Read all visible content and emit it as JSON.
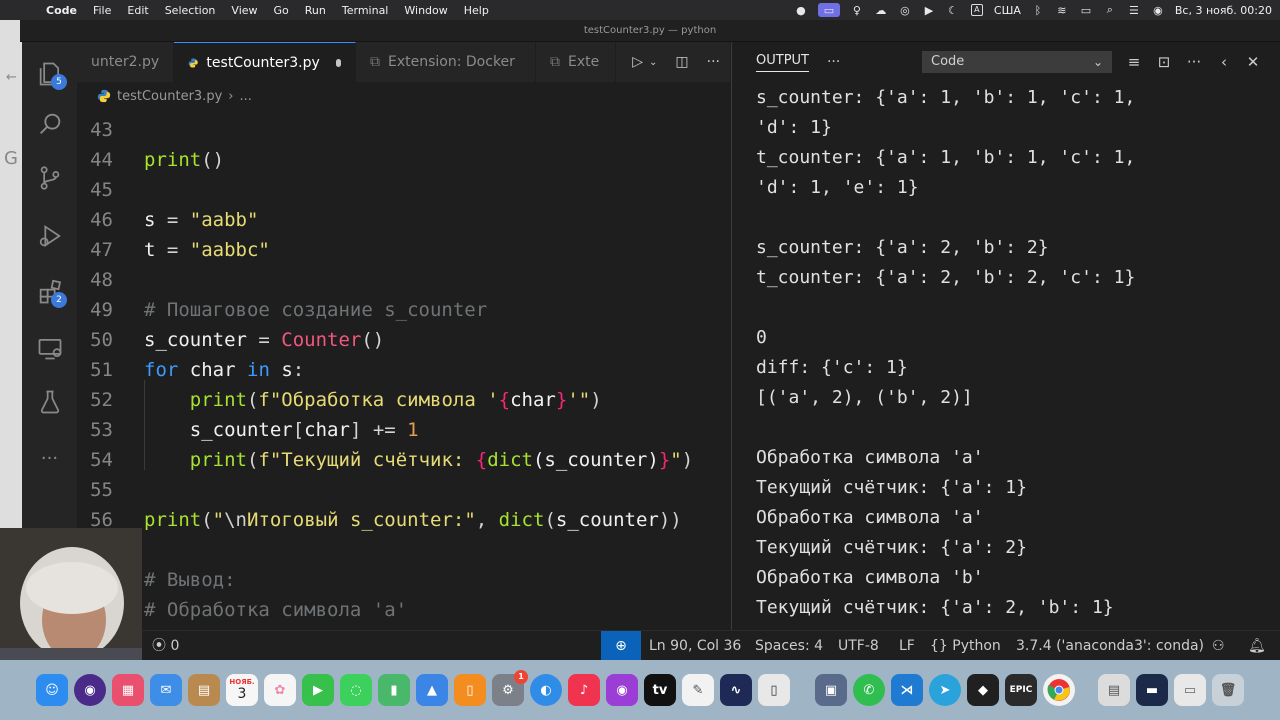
{
  "menubar": {
    "app_name": "Code",
    "items": [
      "File",
      "Edit",
      "Selection",
      "View",
      "Go",
      "Run",
      "Terminal",
      "Window",
      "Help"
    ],
    "keyboard_layout": "США",
    "keyboard_badge": "A",
    "datetime": "Вс, 3 нояб. 00:20"
  },
  "window": {
    "title": "testCounter3.py — python"
  },
  "activity_bar": {
    "explorer_badge": "5",
    "extensions_badge": "2"
  },
  "editor": {
    "tabs": [
      {
        "label": "unter2.py",
        "active": false
      },
      {
        "label": "testCounter3.py",
        "active": true
      },
      {
        "label": "Extension: Docker",
        "active": false
      },
      {
        "label": "Exte",
        "active": false
      }
    ],
    "breadcrumb": {
      "file": "testCounter3.py",
      "more": "..."
    },
    "lines": [
      {
        "num": "43",
        "text": ""
      },
      {
        "num": "44",
        "text": "print()"
      },
      {
        "num": "45",
        "text": ""
      },
      {
        "num": "46",
        "text": "s = \"aabb\""
      },
      {
        "num": "47",
        "text": "t = \"aabbc\""
      },
      {
        "num": "48",
        "text": ""
      },
      {
        "num": "49",
        "text": "# Пошаговое создание s_counter"
      },
      {
        "num": "50",
        "text": "s_counter = Counter()"
      },
      {
        "num": "51",
        "text": "for char in s:"
      },
      {
        "num": "52",
        "text": "    print(f\"Обработка символа '{char}'\")"
      },
      {
        "num": "53",
        "text": "    s_counter[char] += 1"
      },
      {
        "num": "54",
        "text": "    print(f\"Текущий счётчик: {dict(s_counter)}\")"
      },
      {
        "num": "55",
        "text": ""
      },
      {
        "num": "56",
        "text": "print(\"\\nИтоговый s_counter:\", dict(s_counter))"
      },
      {
        "num": "",
        "text": ""
      },
      {
        "num": "",
        "text": "# Вывод:"
      },
      {
        "num": "",
        "text": "# Обработка символа 'a'"
      }
    ]
  },
  "output": {
    "title": "OUTPUT",
    "more": "···",
    "channel": "Code",
    "lines": [
      "s_counter: {'a': 1, 'b': 1, 'c': 1,",
      "'d': 1}",
      "t_counter: {'a': 1, 'b': 1, 'c': 1,",
      "'d': 1, 'e': 1}",
      "",
      "s_counter: {'a': 2, 'b': 2}",
      "t_counter: {'a': 2, 'b': 2, 'c': 1}",
      "",
      "0",
      "diff: {'c': 1}",
      "[('a', 2), ('b', 2)]",
      "",
      "Обработка символа 'a'",
      "Текущий счётчик: {'a': 1}",
      "Обработка символа 'a'",
      "Текущий счётчик: {'a': 2}",
      "Обработка символа 'b'",
      "Текущий счётчик: {'a': 2, 'b': 1}"
    ]
  },
  "statusbar": {
    "ports": "0",
    "position": "Ln 90, Col 36",
    "spaces": "Spaces: 4",
    "encoding": "UTF-8",
    "eol": "LF",
    "language": "Python",
    "interpreter": "3.7.4 ('anaconda3': conda)"
  },
  "dock": {
    "calendar_month": "НОЯБ.",
    "calendar_day": "3",
    "badge_count": "1",
    "epic_label": "EPIC"
  },
  "colors": {
    "accent": "#3794ff",
    "statusbar_highlight": "#0a63b8",
    "badge": "#3b7ad9"
  }
}
